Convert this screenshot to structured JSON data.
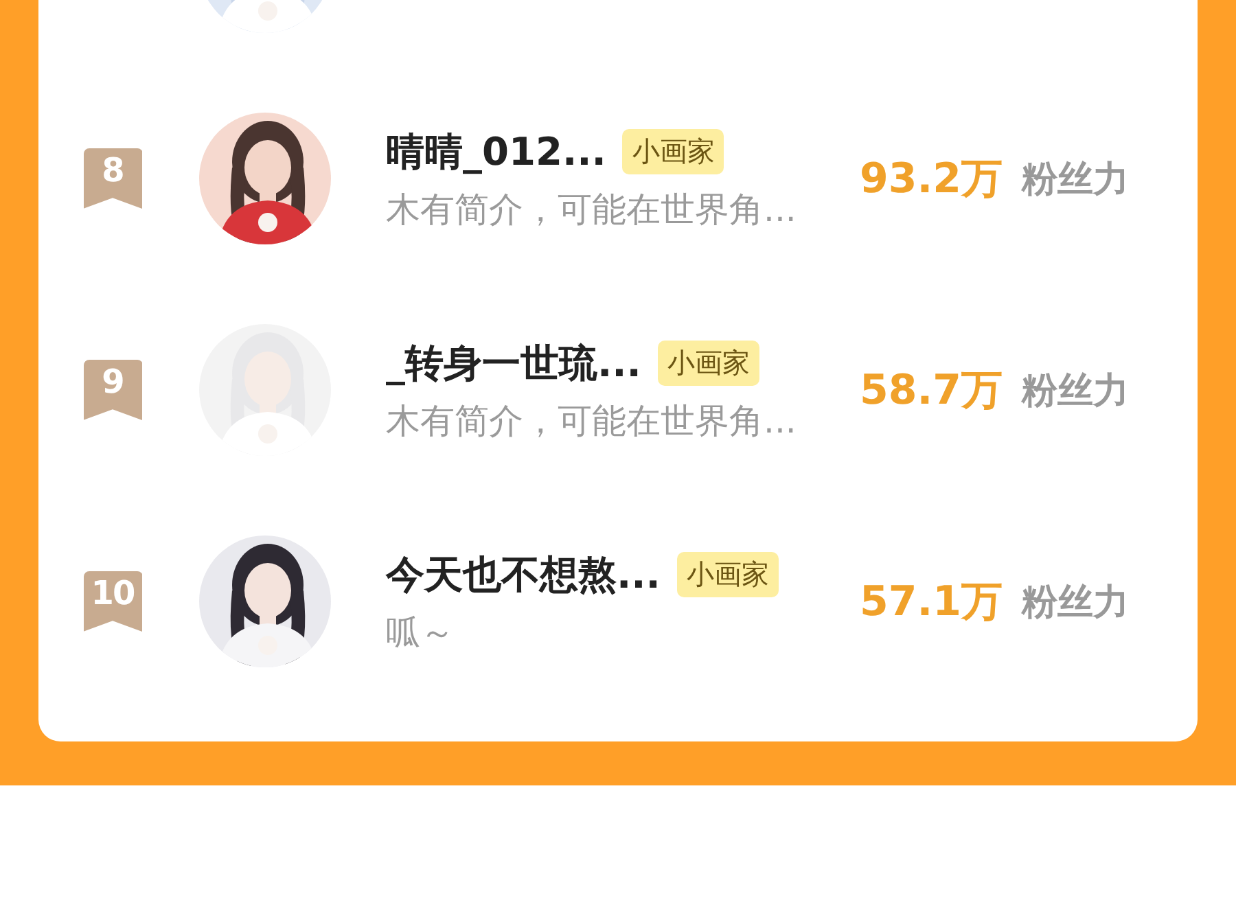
{
  "rows": [
    {
      "kind": "partial"
    },
    {
      "kind": "full",
      "rank": "8",
      "name": "晴晴_012...",
      "tag": "小画家",
      "bio": "木有简介，可能在世界角...",
      "count": "93.2万",
      "unit": "粉丝力"
    },
    {
      "kind": "full",
      "rank": "9",
      "name": "_转身一世琉...",
      "tag": "小画家",
      "bio": "木有简介，可能在世界角...",
      "count": "58.7万",
      "unit": "粉丝力"
    },
    {
      "kind": "full",
      "rank": "10",
      "name": "今天也不想熬...",
      "tag": "小画家",
      "bio": "呱～",
      "count": "57.1万",
      "unit": "粉丝力"
    }
  ]
}
